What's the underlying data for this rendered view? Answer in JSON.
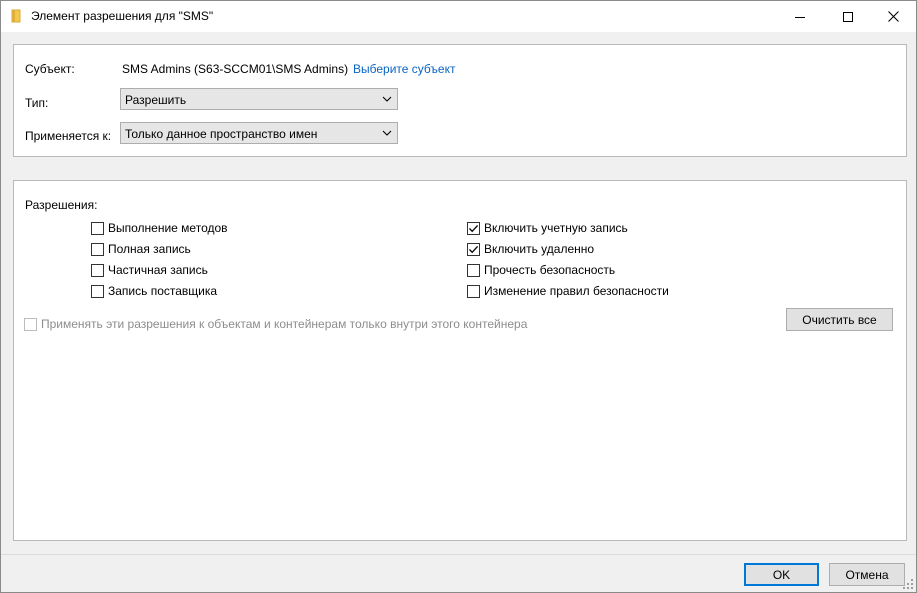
{
  "window": {
    "title": "Элемент разрешения для \"SMS\""
  },
  "subject": {
    "label": "Субъект:",
    "value": "SMS Admins (S63-SCCM01\\SMS Admins)",
    "select_link": "Выберите субъект"
  },
  "type": {
    "label": "Тип:",
    "selected": "Разрешить"
  },
  "applies_to": {
    "label": "Применяется к:",
    "selected": "Только данное пространство имен"
  },
  "permissions": {
    "label": "Разрешения:",
    "left": [
      {
        "label": "Выполнение методов",
        "checked": false
      },
      {
        "label": "Полная запись",
        "checked": false
      },
      {
        "label": "Частичная запись",
        "checked": false
      },
      {
        "label": "Запись поставщика",
        "checked": false
      }
    ],
    "right": [
      {
        "label": "Включить учетную запись",
        "checked": true
      },
      {
        "label": "Включить удаленно",
        "checked": true
      },
      {
        "label": "Прочесть безопасность",
        "checked": false
      },
      {
        "label": "Изменение правил безопасности",
        "checked": false
      }
    ],
    "apply_inside": {
      "label": "Применять эти разрешения к объектам и контейнерам только внутри этого контейнера",
      "checked": false,
      "enabled": false
    },
    "clear_all_label": "Очистить все"
  },
  "footer": {
    "ok_label": "OK",
    "cancel_label": "Отмена"
  },
  "colors": {
    "link": "#0a64c2",
    "default_button_border": "#0078d7",
    "folder_icon": "#e8b84a"
  }
}
